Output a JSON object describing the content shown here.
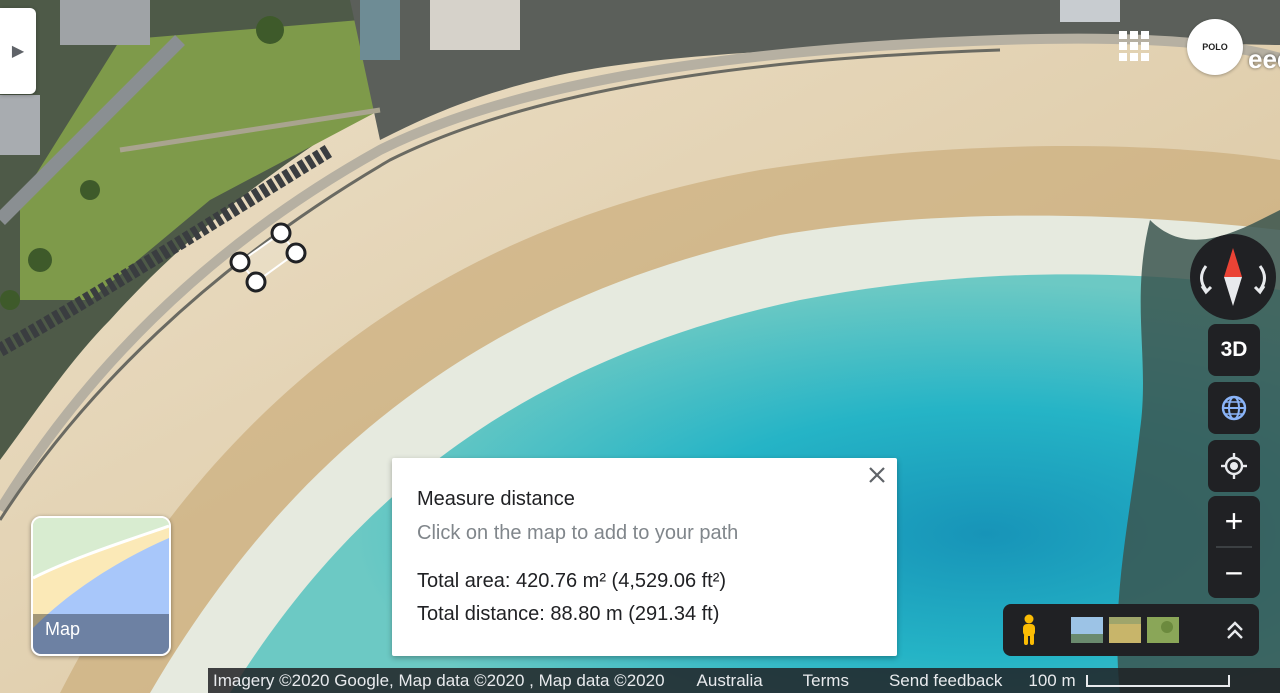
{
  "map": {
    "collapse_icon": "chevron-right-icon",
    "apps_icon": "apps-grid-icon",
    "avatar_text": "POLO",
    "corner_text": "eedo"
  },
  "controls": {
    "three_d_label": "3D",
    "compass_icon": "compass-icon",
    "globe_icon": "globe-icon",
    "location_icon": "my-location-icon",
    "zoom_in_label": "+",
    "zoom_out_label": "−"
  },
  "minimap": {
    "label": "Map"
  },
  "measure": {
    "title": "Measure distance",
    "hint": "Click on the map to add to your path",
    "total_area": "Total area: 420.76 m² (4,529.06 ft²)",
    "total_distance": "Total distance: 88.80 m (291.34 ft)",
    "close_icon": "close-icon"
  },
  "footer": {
    "imagery": "Imagery ©2020 Google, Map data ©2020 , Map data ©2020",
    "country": "Australia",
    "terms": "Terms",
    "feedback": "Send feedback",
    "scale": "100 m"
  },
  "colors": {
    "sand": "#e6d2b0",
    "water": "#29b6c8",
    "grass": "#7e9a4a",
    "control_bg": "#202124"
  }
}
